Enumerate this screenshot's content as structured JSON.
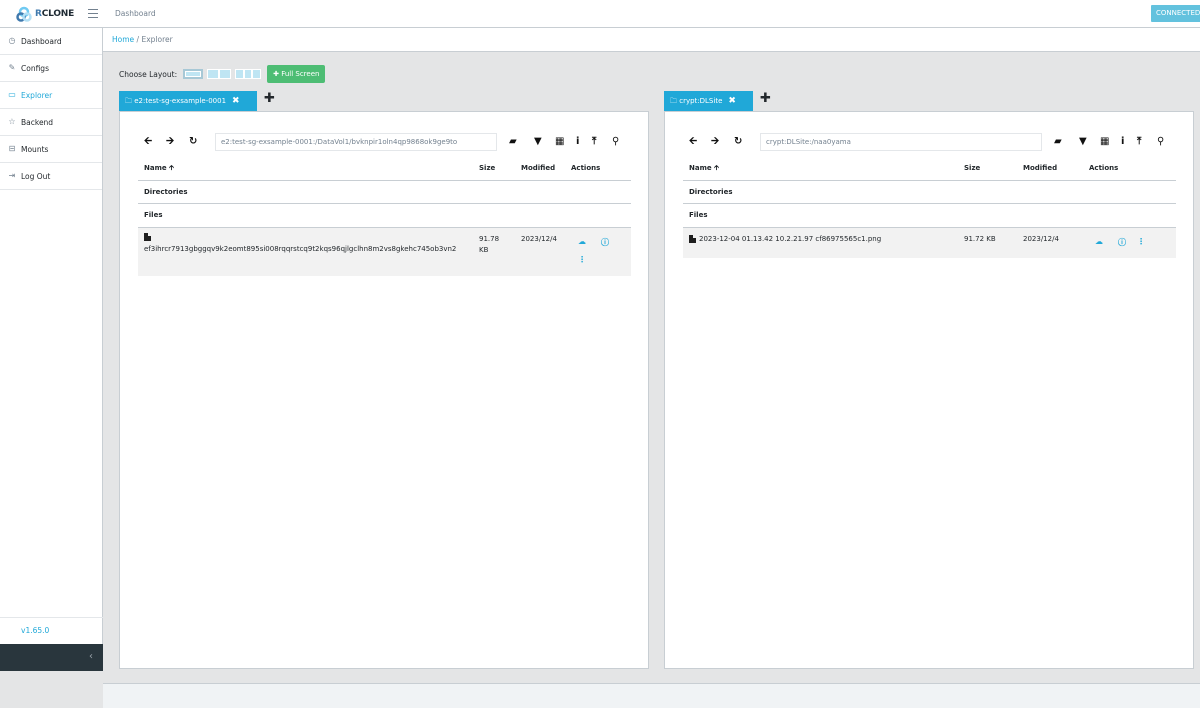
{
  "header": {
    "logo_text_r": "R",
    "logo_text_rest": "CLONE",
    "dashboard_link": "Dashboard",
    "status_badge": "CONNECTED"
  },
  "sidebar": {
    "items": [
      {
        "label": "Dashboard",
        "icon": "speedometer-icon",
        "glyph": "◷",
        "active": false
      },
      {
        "label": "Configs",
        "icon": "pencil-icon",
        "glyph": "✎",
        "active": false
      },
      {
        "label": "Explorer",
        "icon": "monitor-icon",
        "glyph": "▭",
        "active": true
      },
      {
        "label": "Backend",
        "icon": "star-icon",
        "glyph": "☆",
        "active": false
      },
      {
        "label": "Mounts",
        "icon": "drive-icon",
        "glyph": "⊟",
        "active": false
      },
      {
        "label": "Log Out",
        "icon": "logout-icon",
        "glyph": "⇥",
        "active": false
      }
    ],
    "version": "v1.65.0",
    "collapse_glyph": "‹"
  },
  "breadcrumb": {
    "home": "Home",
    "separator": "/",
    "current": "Explorer"
  },
  "layout": {
    "label": "Choose Layout:",
    "fullscreen_label": "✚ Full Screen"
  },
  "panes": [
    {
      "tab_label": "🗀 e2:test-sg-exsample-0001",
      "close": "✖",
      "add": "✚",
      "path": "e2:test-sg-exsample-0001:/DataVol1/bvknpir1oln4qp9868ok9ge9to",
      "columns": {
        "name": "Name 🡩",
        "size": "Size",
        "modified": "Modified",
        "actions": "Actions"
      },
      "directories_label": "Directories",
      "files_label": "Files",
      "files": [
        {
          "name": "ef3ihrcr7913gbggqv9k2eomt895si008rqqrstcq9t2kqs96qjlgclhn8m2vs8gkehc745ob3vn2",
          "size": "91.78 KB",
          "size_line1": "91.78",
          "size_line2": "KB",
          "modified": "2023/12/4"
        }
      ]
    },
    {
      "tab_label": "🗀 crypt:DLSite",
      "close": "✖",
      "add": "✚",
      "path": "crypt:DLSite:/naa0yama",
      "columns": {
        "name": "Name 🡩",
        "size": "Size",
        "modified": "Modified",
        "actions": "Actions"
      },
      "directories_label": "Directories",
      "files_label": "Files",
      "files": [
        {
          "name": "2023-12-04 01.13.42 10.2.21.97 cf86975565c1.png",
          "size": "91.72 KB",
          "modified": "2023/12/4"
        }
      ]
    }
  ],
  "toolbar_glyphs": {
    "back": "🡨",
    "forward": "🡪",
    "refresh": "↻",
    "new_folder": "▰",
    "filter": "▼",
    "grid": "▦",
    "info": "i",
    "upload": "⤒",
    "search": "⚲"
  },
  "action_glyphs": {
    "download": "☁",
    "info": "ⓘ",
    "more": "⋮"
  }
}
